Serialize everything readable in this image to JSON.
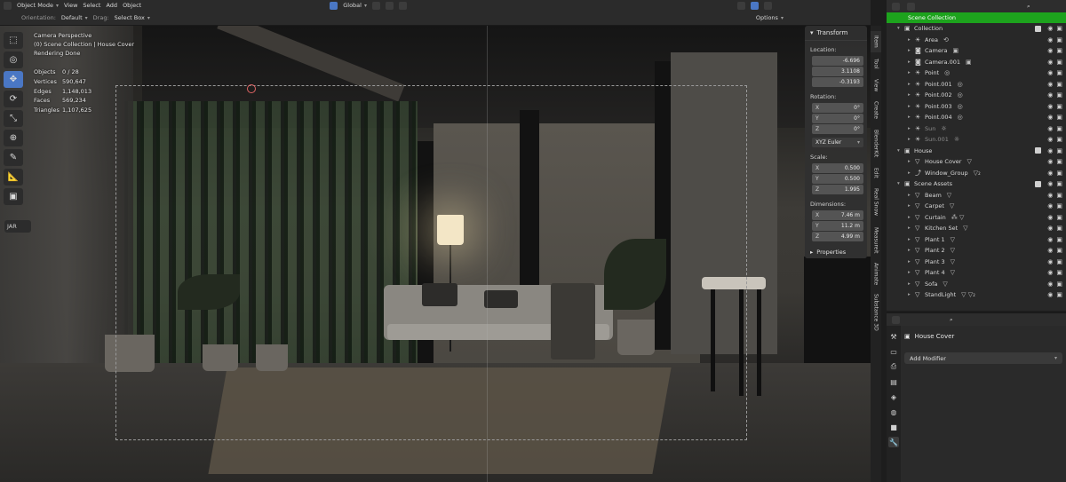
{
  "header": {
    "mode": "Object Mode",
    "menus": [
      "View",
      "Select",
      "Add",
      "Object"
    ],
    "orientation_label": "Orientation:",
    "orientation_value": "Default",
    "drag_label": "Drag:",
    "drag_value": "Select Box",
    "transform_orientation": "Global",
    "options_label": "Options"
  },
  "viewport": {
    "camera_label": "Camera Perspective",
    "collection_label": "(0) Scene Collection | House Cover",
    "render_status": "Rendering Done",
    "stats": [
      {
        "k": "Objects",
        "v": "0 / 28"
      },
      {
        "k": "Vertices",
        "v": "590,647"
      },
      {
        "k": "Edges",
        "v": "1,148,013"
      },
      {
        "k": "Faces",
        "v": "569,234"
      },
      {
        "k": "Triangles",
        "v": "1,107,625"
      }
    ],
    "tool_icons": [
      "select-box-icon",
      "cursor-icon",
      "move-icon",
      "rotate-icon",
      "scale-icon",
      "transform-icon",
      "annotate-icon",
      "measure-icon",
      "add-cube-icon"
    ],
    "jar_label": "JAR"
  },
  "transform_panel": {
    "title": "Transform",
    "location_label": "Location:",
    "location": [
      "-6.696",
      "3.1108",
      "-0.3193"
    ],
    "rotation_label": "Rotation:",
    "rotation": [
      {
        "axis": "X",
        "value": "0°"
      },
      {
        "axis": "Y",
        "value": "0°"
      },
      {
        "axis": "Z",
        "value": "0°"
      }
    ],
    "rotation_mode": "XYZ Euler",
    "scale_label": "Scale:",
    "scale": [
      {
        "axis": "X",
        "value": "0.500"
      },
      {
        "axis": "Y",
        "value": "0.500"
      },
      {
        "axis": "Z",
        "value": "1.995"
      }
    ],
    "dimensions_label": "Dimensions:",
    "dimensions": [
      {
        "axis": "X",
        "value": "7.46 m"
      },
      {
        "axis": "Y",
        "value": "11.2 m"
      },
      {
        "axis": "Z",
        "value": "4.99 m"
      }
    ],
    "properties_label": "Properties"
  },
  "side_tabs": [
    "Item",
    "Tool",
    "View",
    "Create",
    "BlenderKit",
    "Edit",
    "Real Snow",
    "Measureit",
    "Animate",
    "Substance 3D"
  ],
  "outliner": {
    "scene_collection": "Scene Collection",
    "rows": [
      {
        "indent": 1,
        "expander": "▾",
        "icon": "▣",
        "name": "Collection",
        "dim": false,
        "extra": "",
        "check": true
      },
      {
        "indent": 2,
        "expander": "▸",
        "icon": "☀",
        "name": "Area",
        "dim": false,
        "extra": "⟲",
        "check": false
      },
      {
        "indent": 2,
        "expander": "▸",
        "icon": "◙",
        "name": "Camera",
        "dim": false,
        "extra": "▣",
        "check": false
      },
      {
        "indent": 2,
        "expander": "▸",
        "icon": "◙",
        "name": "Camera.001",
        "dim": false,
        "extra": "▣",
        "check": false
      },
      {
        "indent": 2,
        "expander": "▸",
        "icon": "☀",
        "name": "Point",
        "dim": false,
        "extra": "◎",
        "check": false
      },
      {
        "indent": 2,
        "expander": "▸",
        "icon": "☀",
        "name": "Point.001",
        "dim": false,
        "extra": "◎",
        "check": false
      },
      {
        "indent": 2,
        "expander": "▸",
        "icon": "☀",
        "name": "Point.002",
        "dim": false,
        "extra": "◎",
        "check": false
      },
      {
        "indent": 2,
        "expander": "▸",
        "icon": "☀",
        "name": "Point.003",
        "dim": false,
        "extra": "◎",
        "check": false
      },
      {
        "indent": 2,
        "expander": "▸",
        "icon": "☀",
        "name": "Point.004",
        "dim": false,
        "extra": "◎",
        "check": false
      },
      {
        "indent": 2,
        "expander": "▸",
        "icon": "☀",
        "name": "Sun",
        "dim": true,
        "extra": "☼",
        "check": false
      },
      {
        "indent": 2,
        "expander": "▸",
        "icon": "☀",
        "name": "Sun.001",
        "dim": true,
        "extra": "☼",
        "check": false
      },
      {
        "indent": 1,
        "expander": "▾",
        "icon": "▣",
        "name": "House",
        "dim": false,
        "extra": "",
        "check": true
      },
      {
        "indent": 2,
        "expander": "▸",
        "icon": "▽",
        "name": "House Cover",
        "dim": false,
        "extra": "▽",
        "check": false
      },
      {
        "indent": 2,
        "expander": "▸",
        "icon": "⤴",
        "name": "Window_Group",
        "dim": false,
        "extra": "▽₂",
        "check": false
      },
      {
        "indent": 1,
        "expander": "▾",
        "icon": "▣",
        "name": "Scene Assets",
        "dim": false,
        "extra": "",
        "check": true
      },
      {
        "indent": 2,
        "expander": "▸",
        "icon": "▽",
        "name": "Beam",
        "dim": false,
        "extra": "▽",
        "check": false
      },
      {
        "indent": 2,
        "expander": "▸",
        "icon": "▽",
        "name": "Carpet",
        "dim": false,
        "extra": "▽",
        "check": false
      },
      {
        "indent": 2,
        "expander": "▸",
        "icon": "▽",
        "name": "Curtain",
        "dim": false,
        "extra": "⁂ ▽",
        "check": false
      },
      {
        "indent": 2,
        "expander": "▸",
        "icon": "▽",
        "name": "Kitchen Set",
        "dim": false,
        "extra": "▽",
        "check": false
      },
      {
        "indent": 2,
        "expander": "▸",
        "icon": "▽",
        "name": "Plant 1",
        "dim": false,
        "extra": "▽",
        "check": false
      },
      {
        "indent": 2,
        "expander": "▸",
        "icon": "▽",
        "name": "Plant 2",
        "dim": false,
        "extra": "▽",
        "check": false
      },
      {
        "indent": 2,
        "expander": "▸",
        "icon": "▽",
        "name": "Plant 3",
        "dim": false,
        "extra": "▽",
        "check": false
      },
      {
        "indent": 2,
        "expander": "▸",
        "icon": "▽",
        "name": "Plant 4",
        "dim": false,
        "extra": "▽",
        "check": false
      },
      {
        "indent": 2,
        "expander": "▸",
        "icon": "▽",
        "name": "Sofa",
        "dim": false,
        "extra": "▽",
        "check": false
      },
      {
        "indent": 2,
        "expander": "▸",
        "icon": "▽",
        "name": "StandLight",
        "dim": false,
        "extra": "▽ ▽₂",
        "check": false
      }
    ]
  },
  "properties": {
    "object_name": "House Cover",
    "add_modifier": "Add Modifier",
    "tab_icons": [
      "tool-icon",
      "render-icon",
      "output-icon",
      "view-layer-icon",
      "scene-icon",
      "world-icon",
      "object-icon",
      "modifier-icon"
    ]
  },
  "colors": {
    "accent": "#4a77c4",
    "outliner_active": "#1da31d",
    "panel_bg": "#2b2b2b"
  }
}
